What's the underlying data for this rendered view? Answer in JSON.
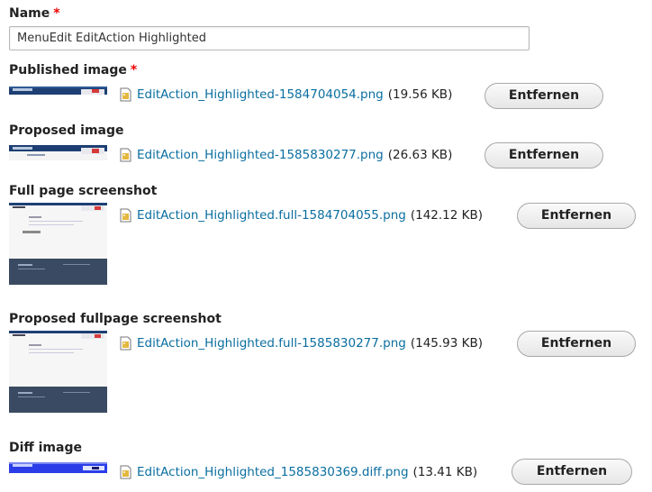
{
  "name": {
    "label": "Name",
    "required_mark": "*",
    "value": "MenuEdit EditAction Highlighted"
  },
  "fields": [
    {
      "label": "Published image",
      "required_mark": "*",
      "filename": "EditAction_Highlighted-1584704054.png",
      "size": "(19.56 KB)",
      "button": "Entfernen"
    },
    {
      "label": "Proposed image",
      "filename": "EditAction_Highlighted-1585830277.png",
      "size": "(26.63 KB)",
      "button": "Entfernen"
    },
    {
      "label": "Full page screenshot",
      "filename": "EditAction_Highlighted.full-1584704055.png",
      "size": "(142.12 KB)",
      "button": "Entfernen"
    },
    {
      "label": "Proposed fullpage screenshot",
      "filename": "EditAction_Highlighted.full-1585830277.png",
      "size": "(145.93 KB)",
      "button": "Entfernen"
    },
    {
      "label": "Diff image",
      "filename": "EditAction_Highlighted_1585830369.diff.png",
      "size": "(13.41 KB)",
      "button": "Entfernen"
    }
  ],
  "icons": {
    "file": "image-file-icon"
  },
  "colors": {
    "link": "#0a6ea0",
    "required": "#ee0000"
  }
}
